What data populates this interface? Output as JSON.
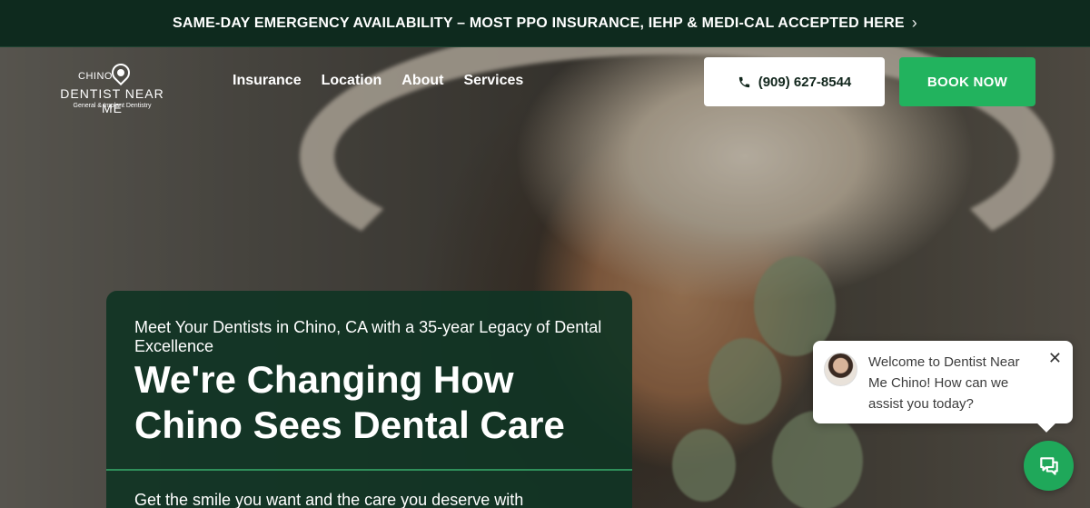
{
  "announcement": {
    "text": "SAME-DAY EMERGENCY AVAILABILITY – MOST PPO INSURANCE, IEHP & MEDI-CAL ACCEPTED HERE",
    "chevron_icon": "chevron-right-icon"
  },
  "logo": {
    "city": "CHINO",
    "name": "DENTIST NEAR ME",
    "tagline": "General & Implant Dentistry"
  },
  "nav": {
    "items": [
      "Insurance",
      "Location",
      "About",
      "Services"
    ]
  },
  "header": {
    "phone": "(909) 627-8544",
    "book_label": "BOOK NOW"
  },
  "hero": {
    "eyebrow": "Meet Your Dentists in Chino, CA with a 35-year Legacy of Dental Excellence",
    "headline": "We're Changing How Chino Sees Dental Care",
    "subtext": "Get the smile you want and the care you deserve with"
  },
  "chat": {
    "message": "Welcome to Dentist Near Me Chino! How can we assist you today?",
    "close_icon": "close-icon",
    "launcher_icon": "chat-icon"
  },
  "colors": {
    "topbar_bg": "#0e2a1e",
    "card_bg": "#103424",
    "accent_green": "#22b35e"
  }
}
